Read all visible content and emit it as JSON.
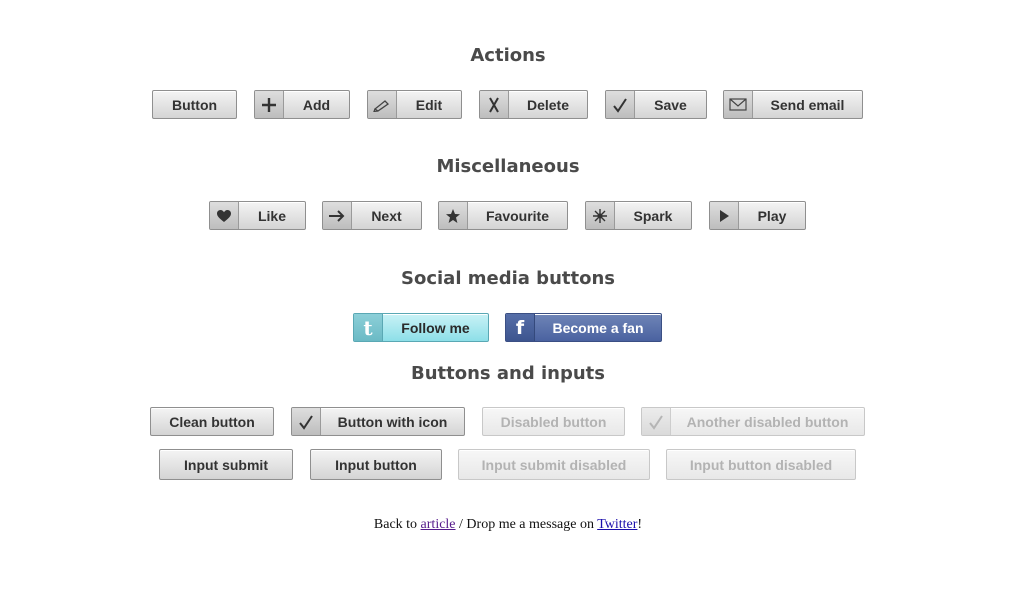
{
  "sections": {
    "actions": {
      "heading": "Actions",
      "buttons": {
        "button": "Button",
        "add": "Add",
        "edit": "Edit",
        "delete": "Delete",
        "save": "Save",
        "send_email": "Send email"
      }
    },
    "misc": {
      "heading": "Miscellaneous",
      "buttons": {
        "like": "Like",
        "next": "Next",
        "favourite": "Favourite",
        "spark": "Spark",
        "play": "Play"
      }
    },
    "social": {
      "heading": "Social media buttons",
      "twitter_glyph": "t",
      "twitter_label": "Follow me",
      "facebook_glyph": "f",
      "facebook_label": "Become a fan",
      "colors": {
        "twitter": "#8ddfe8",
        "facebook": "#4a62a0"
      }
    },
    "inputs": {
      "heading": "Buttons and inputs",
      "clean_button": "Clean button",
      "button_with_icon": "Button with icon",
      "disabled_button": "Disabled button",
      "another_disabled_button": "Another disabled button",
      "input_submit": "Input submit",
      "input_button": "Input button",
      "input_submit_disabled": "Input submit disabled",
      "input_button_disabled": "Input button disabled"
    }
  },
  "icons": {
    "add": "plus-icon",
    "edit": "pencil-icon",
    "delete": "cross-icon",
    "save": "checkmark-icon",
    "send_email": "envelope-icon",
    "like": "heart-icon",
    "next": "arrow-right-icon",
    "favourite": "star-icon",
    "spark": "spark-icon",
    "play": "play-icon"
  },
  "footer": {
    "prefix": "Back to ",
    "article_link": "article",
    "middle": " / Drop me a message on ",
    "twitter_link": "Twitter",
    "suffix": "!"
  }
}
